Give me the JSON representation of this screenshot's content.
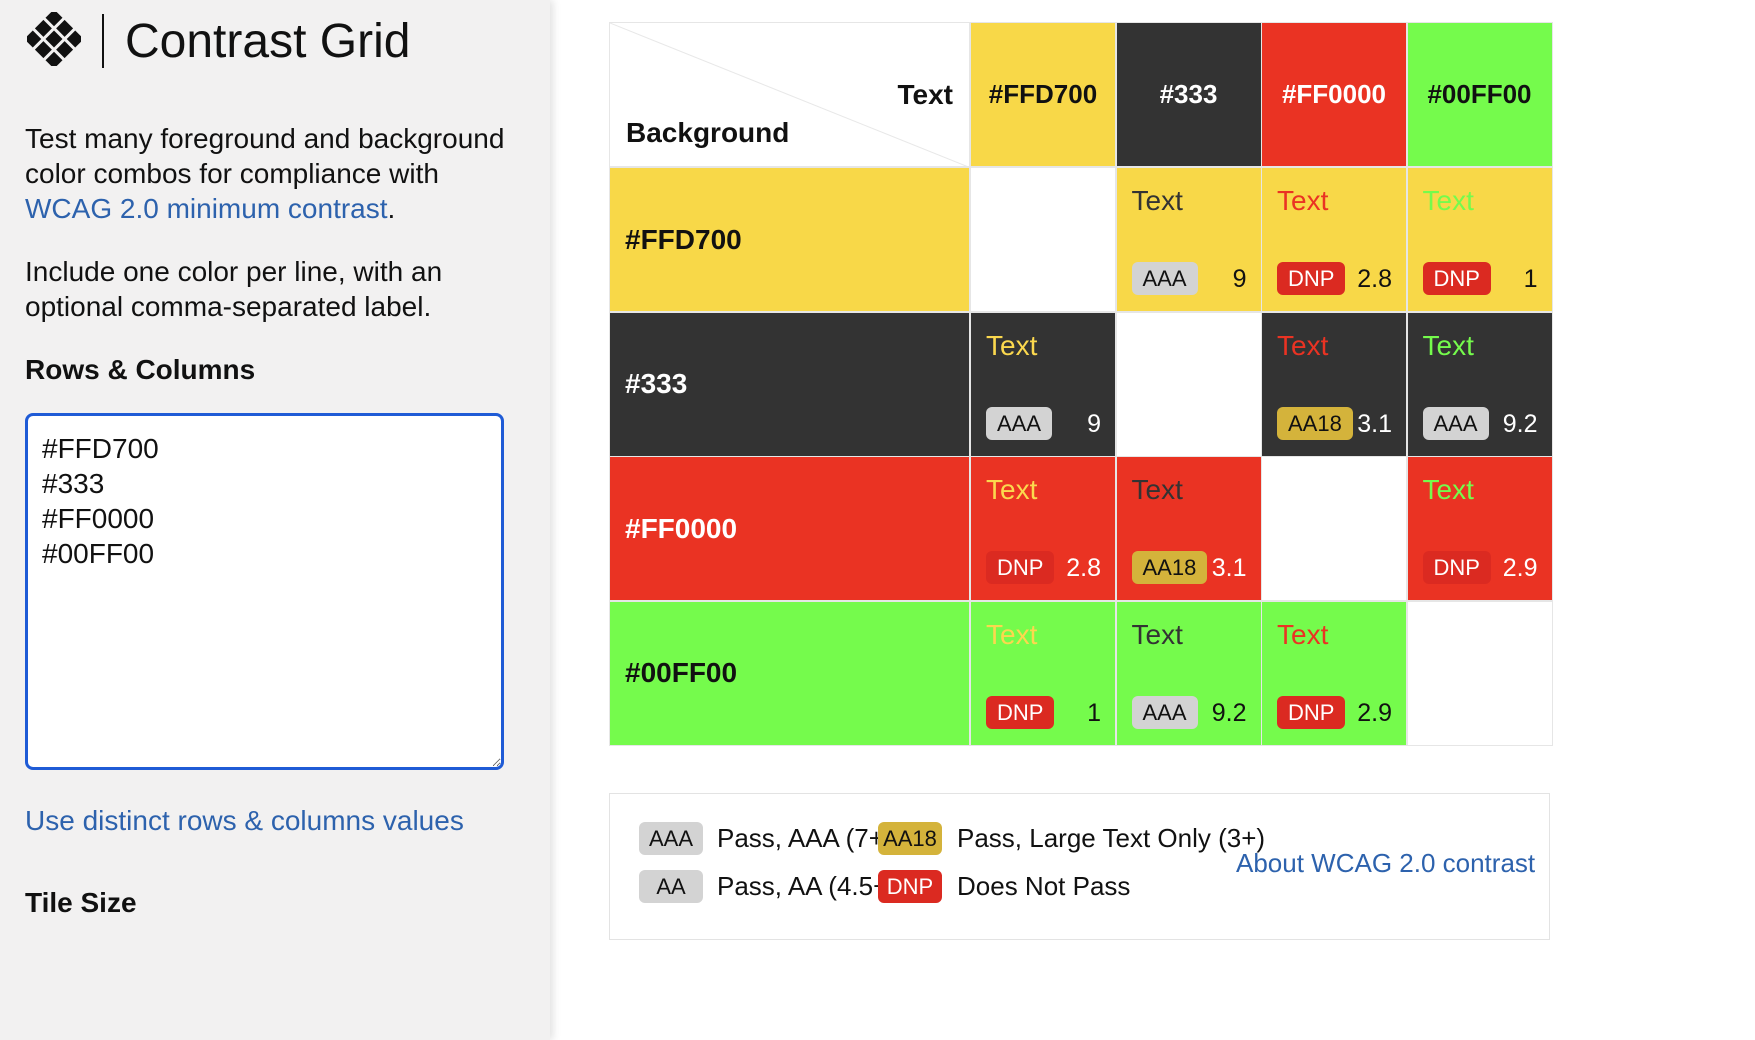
{
  "app": {
    "title": "Contrast Grid",
    "logo_icon": "contrast-grid-logo-icon"
  },
  "sidebar": {
    "intro_1_text": "Test many foreground and background color combos for compliance with ",
    "intro_1_link": "WCAG 2.0 minimum contrast",
    "intro_1_end": ".",
    "intro_2": "Include one color per line, with an optional comma-separated label.",
    "rows_label": "Rows & Columns",
    "rows_value": "#FFD700\n#333\n#FF0000\n#00FF00",
    "distinct_link": "Use distinct rows & columns values",
    "tile_label": "Tile Size"
  },
  "grid": {
    "corner_text": "Text",
    "corner_background": "Background",
    "colors": [
      {
        "label": "#FFD700",
        "hex": "#f8d848",
        "text_hex": "#ffd700"
      },
      {
        "label": "#333",
        "hex": "#333333",
        "text_hex": "#fde46a"
      },
      {
        "label": "#FF0000",
        "hex": "#ea3323",
        "text_hex": "#ea3323"
      },
      {
        "label": "#00FF00",
        "hex": "#75fb4c",
        "text_hex": "#75fb4c"
      }
    ],
    "column_header_text_colors": [
      "#111111",
      "#ffffff",
      "#ffffff",
      "#111111"
    ],
    "row_header_text_colors": [
      "#111111",
      "#ffffff",
      "#ffffff",
      "#111111"
    ],
    "sample_text": "Text",
    "rows": [
      [
        null,
        {
          "text_color": "#333333",
          "badge": "AAA",
          "ratio": "9",
          "ratio_color": "#111111"
        },
        {
          "text_color": "#ea3323",
          "badge": "DNP",
          "ratio": "2.8",
          "ratio_color": "#111111"
        },
        {
          "text_color": "#75fb4c",
          "badge": "DNP",
          "ratio": "1",
          "ratio_color": "#111111"
        }
      ],
      [
        {
          "text_color": "#fbd84e",
          "badge": "AAA",
          "ratio": "9",
          "ratio_color": "#ffffff"
        },
        null,
        {
          "text_color": "#ea3323",
          "badge": "AA18",
          "ratio": "3.1",
          "ratio_color": "#ffffff"
        },
        {
          "text_color": "#75fb4c",
          "badge": "AAA",
          "ratio": "9.2",
          "ratio_color": "#ffffff"
        }
      ],
      [
        {
          "text_color": "#fbd84e",
          "badge": "DNP",
          "ratio": "2.8",
          "ratio_color": "#ffffff"
        },
        {
          "text_color": "#333333",
          "badge": "AA18",
          "ratio": "3.1",
          "ratio_color": "#ffffff"
        },
        null,
        {
          "text_color": "#75fb4c",
          "badge": "DNP",
          "ratio": "2.9",
          "ratio_color": "#ffffff"
        }
      ],
      [
        {
          "text_color": "#fbd84e",
          "badge": "DNP",
          "ratio": "1",
          "ratio_color": "#111111"
        },
        {
          "text_color": "#333333",
          "badge": "AAA",
          "ratio": "9.2",
          "ratio_color": "#111111"
        },
        {
          "text_color": "#ea3323",
          "badge": "DNP",
          "ratio": "2.9",
          "ratio_color": "#111111"
        },
        null
      ]
    ]
  },
  "legend": {
    "aaa_badge": "AAA",
    "aaa_text": "Pass, AAA (7+)",
    "aa18_badge": "AA18",
    "aa18_text": "Pass, Large Text Only (3+)",
    "aa_badge": "AA",
    "aa_text": "Pass, AA (4.5+)",
    "dnp_badge": "DNP",
    "dnp_text": "Does Not Pass",
    "about_link": "About WCAG 2.0 contrast"
  },
  "colors": {
    "link": "#2d62ad",
    "focus_border": "#1f5bd6",
    "sidebar_bg": "#f2f1f1",
    "aaa": "#d3d3d3",
    "aa18": "#d4b33b",
    "dnp": "#db2a21"
  }
}
